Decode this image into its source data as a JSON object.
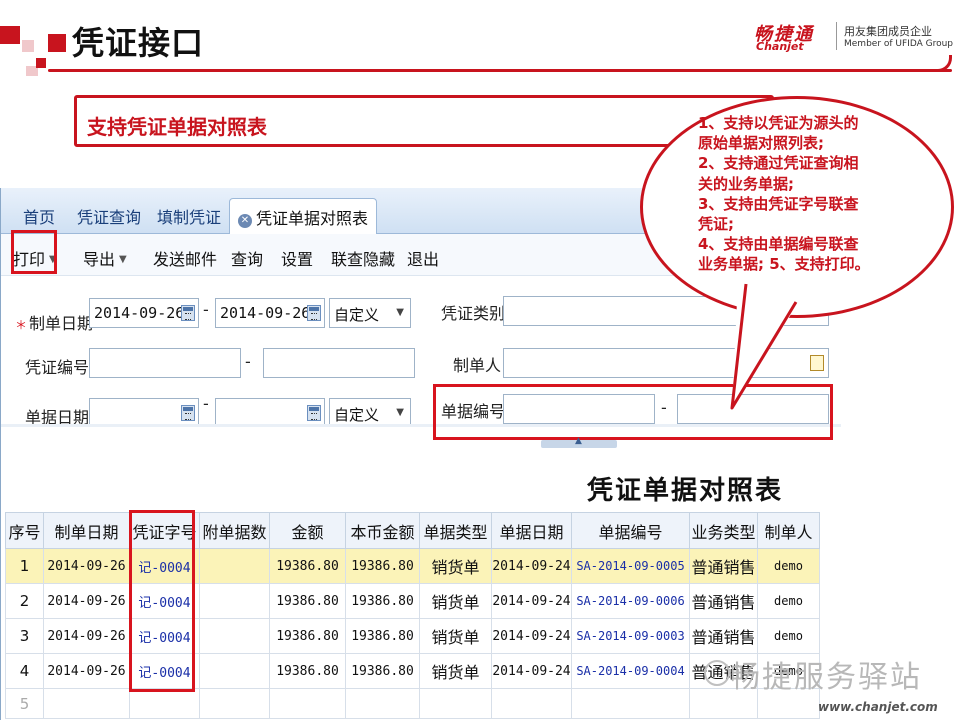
{
  "slide": {
    "title": "凭证接口",
    "subtitle": "支持凭证单据对照表",
    "brand_cn": "畅捷通",
    "brand_en": "Chanjet",
    "brand_tag1": "用友集团成员企业",
    "brand_tag2": "Member of UFIDA Group",
    "accent_color": "#c8141e",
    "watermark": "畅捷服务驿站",
    "website": "www.chanjet.com"
  },
  "callout": {
    "lines": [
      "1、支持以凭证为源头的",
      "原始单据对照列表;",
      "2、支持通过凭证查询相",
      "关的业务单据;",
      "3、支持由凭证字号联查",
      "凭证;",
      "4、支持由单据编号联查",
      "业务单据; 5、支持打印。"
    ]
  },
  "tabs": [
    {
      "label": "首页"
    },
    {
      "label": "凭证查询"
    },
    {
      "label": "填制凭证"
    },
    {
      "label": "凭证单据对照表",
      "active": true
    }
  ],
  "toolbar": {
    "print": "打印",
    "export": "导出",
    "send_mail": "发送邮件",
    "query": "查询",
    "settings": "设置",
    "link_hide": "联查隐藏",
    "exit": "退出"
  },
  "form": {
    "made_date_label": "制单日期",
    "made_date_from": "2014-09-26",
    "made_date_to": "2014-09-26",
    "made_date_range": "自定义",
    "voucher_type_label": "凭证类别",
    "voucher_no_label": "凭证编号",
    "maker_label": "制单人",
    "doc_date_label": "单据日期",
    "doc_date_range": "自定义",
    "doc_no_label": "单据编号",
    "dash": "-"
  },
  "report": {
    "title": "凭证单据对照表",
    "columns": [
      "序号",
      "制单日期",
      "凭证字号",
      "附单据数",
      "金额",
      "本币金额",
      "单据类型",
      "单据日期",
      "单据编号",
      "业务类型",
      "制单人"
    ],
    "rows": [
      {
        "no": "1",
        "made_date": "2014-09-26",
        "voucher": "记-0004",
        "attach": "",
        "amount": "19386.80",
        "local_amount": "19386.80",
        "doc_type": "销货单",
        "doc_date": "2014-09-24",
        "doc_no": "SA-2014-09-0005",
        "biz_type": "普通销售",
        "maker": "demo"
      },
      {
        "no": "2",
        "made_date": "2014-09-26",
        "voucher": "记-0004",
        "attach": "",
        "amount": "19386.80",
        "local_amount": "19386.80",
        "doc_type": "销货单",
        "doc_date": "2014-09-24",
        "doc_no": "SA-2014-09-0006",
        "biz_type": "普通销售",
        "maker": "demo"
      },
      {
        "no": "3",
        "made_date": "2014-09-26",
        "voucher": "记-0004",
        "attach": "",
        "amount": "19386.80",
        "local_amount": "19386.80",
        "doc_type": "销货单",
        "doc_date": "2014-09-24",
        "doc_no": "SA-2014-09-0003",
        "biz_type": "普通销售",
        "maker": "demo"
      },
      {
        "no": "4",
        "made_date": "2014-09-26",
        "voucher": "记-0004",
        "attach": "",
        "amount": "19386.80",
        "local_amount": "19386.80",
        "doc_type": "销货单",
        "doc_date": "2014-09-24",
        "doc_no": "SA-2014-09-0004",
        "biz_type": "普通销售",
        "maker": "demo"
      }
    ],
    "empty_row_no": "5"
  }
}
